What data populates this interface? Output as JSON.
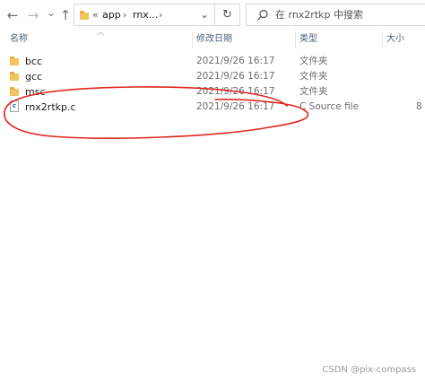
{
  "toolbar": {
    "nav": {
      "back_icon": "←",
      "forward_icon": "→",
      "dropdown_icon": "⌄",
      "up_icon": "↑"
    },
    "address": {
      "overflow": "«",
      "crumbs": [
        "app",
        "rnx..."
      ],
      "separator": "›"
    },
    "refresh_icon": "↻",
    "search_placeholder": "在 rnx2rtkp 中搜索"
  },
  "columns": {
    "name": "名称",
    "date": "修改日期",
    "type": "类型",
    "size": "大小"
  },
  "files": [
    {
      "name": "bcc",
      "date": "2021/9/26 16:17",
      "type": "文件夹",
      "size": "",
      "icon": "folder-icon"
    },
    {
      "name": "gcc",
      "date": "2021/9/26 16:17",
      "type": "文件夹",
      "size": "",
      "icon": "folder-icon"
    },
    {
      "name": "msc",
      "date": "2021/9/26 16:17",
      "type": "文件夹",
      "size": "",
      "icon": "folder-icon"
    },
    {
      "name": "rnx2rtkp.c",
      "date": "2021/9/26 16:17",
      "type": "C Source file",
      "size": "8",
      "icon": "c-source-file-icon"
    }
  ],
  "annotation": {
    "color": "#e0261e",
    "shape": "hand-drawn-ellipse"
  },
  "watermark": "CSDN @pix-compass"
}
